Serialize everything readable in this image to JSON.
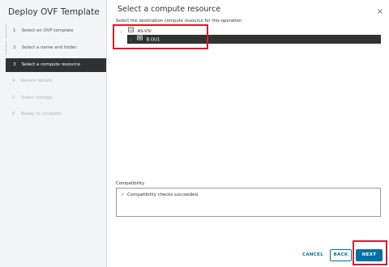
{
  "dialog": {
    "title": "Deploy OVF Template",
    "close_symbol": "×"
  },
  "steps": [
    {
      "number": "1",
      "label": "Select an OVF template",
      "state": "done"
    },
    {
      "number": "2",
      "label": "Select a name and folder",
      "state": "done"
    },
    {
      "number": "3",
      "label": "Select a compute resource",
      "state": "active"
    },
    {
      "number": "4",
      "label": "Review details",
      "state": "disabled"
    },
    {
      "number": "5",
      "label": "Select storage",
      "state": "disabled"
    },
    {
      "number": "6",
      "label": "Ready to complete",
      "state": "disabled"
    }
  ],
  "main": {
    "title": "Select a compute resource",
    "instruction": "Select the destination compute resource for this operation",
    "tree": [
      {
        "label": "AS-VSI",
        "expanded": true,
        "icon": "datacenter-icon",
        "caret": "⌄"
      },
      {
        "label": "B.OU1",
        "expanded": false,
        "selected": true,
        "icon": "cluster-icon",
        "caret": "›"
      }
    ]
  },
  "compatibility": {
    "label": "Compatibility",
    "message": "Compatibility checks succeeded.",
    "status_icon": "check-icon"
  },
  "footer": {
    "cancel_label": "CANCEL",
    "back_label": "BACK",
    "next_label": "NEXT"
  },
  "colors": {
    "accent": "#0072a3",
    "selected_row": "#323232",
    "highlight": "#d21f2a",
    "success": "#4b8a2e"
  }
}
